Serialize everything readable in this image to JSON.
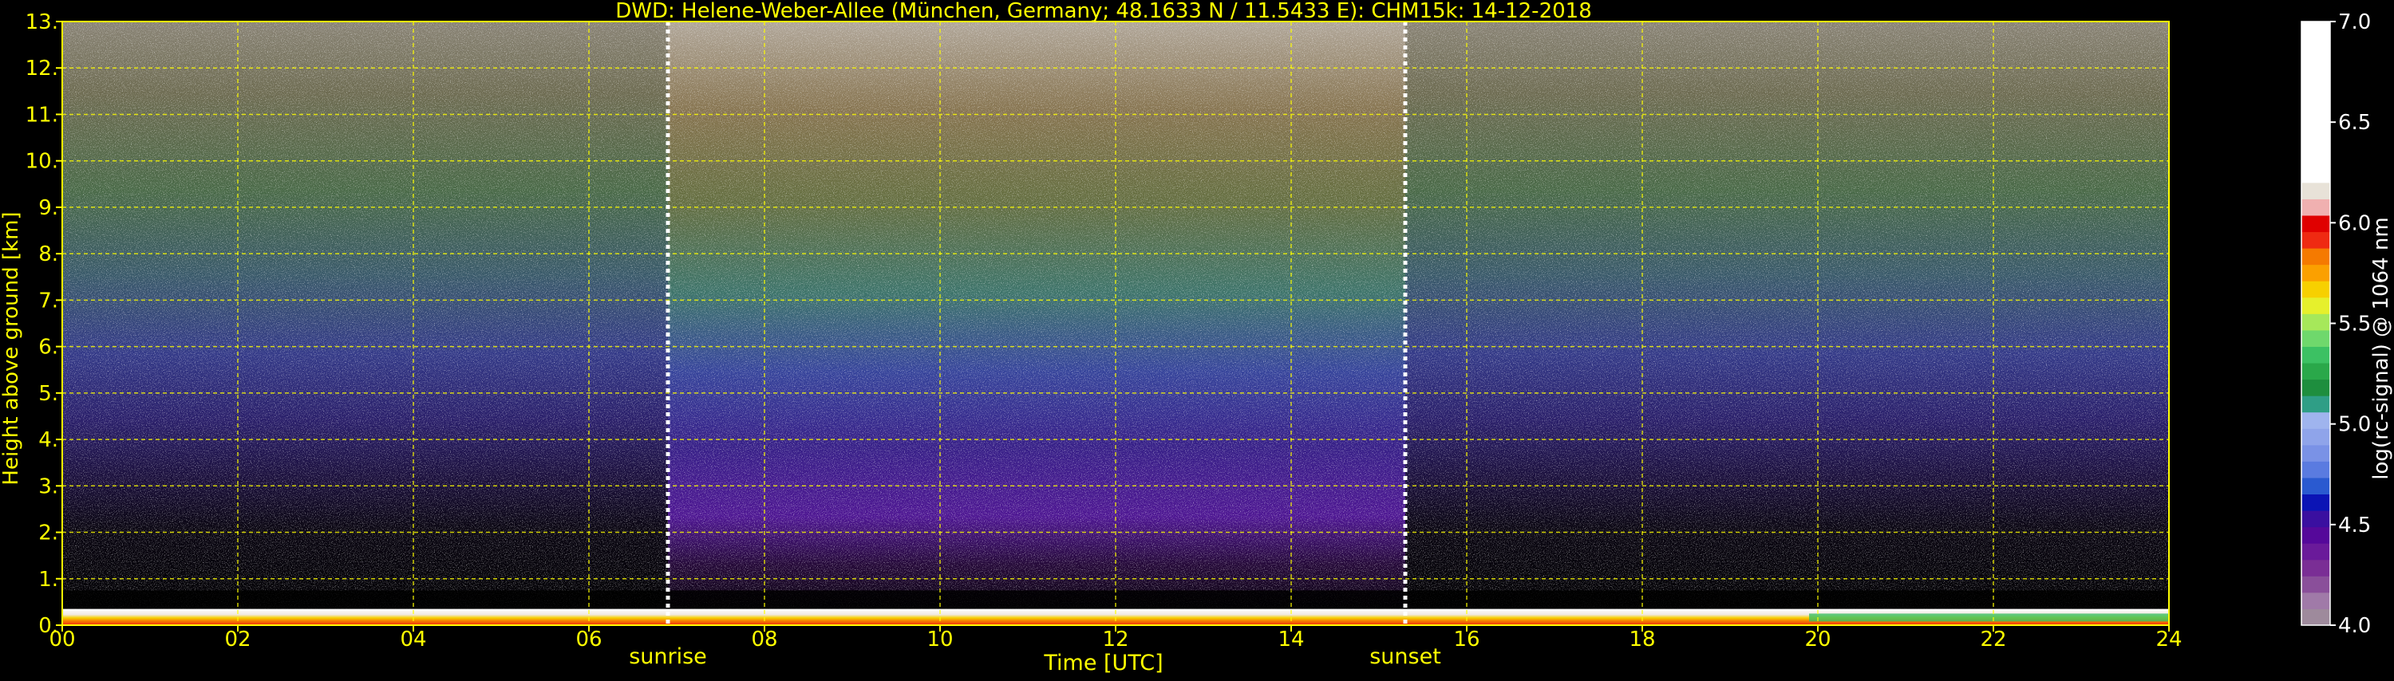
{
  "chart_data": {
    "type": "heatmap",
    "title": "DWD: Helene-Weber-Allee (München, Germany; 48.1633 N / 11.5433 E):    CHM15k: 14-12-2018",
    "xlabel": "Time [UTC]",
    "ylabel": "Height above ground [km]",
    "xlim": [
      0,
      24
    ],
    "ylim": [
      0,
      13
    ],
    "x_ticks": [
      "00",
      "02",
      "04",
      "06",
      "08",
      "10",
      "12",
      "14",
      "16",
      "18",
      "20",
      "22",
      "24"
    ],
    "y_ticks": [
      "0.",
      "1.",
      "2.",
      "3.",
      "4.",
      "5.",
      "6.",
      "7.",
      "8.",
      "9.",
      "10.",
      "11.",
      "12.",
      "13."
    ],
    "grid": true,
    "markers": [
      {
        "label": "sunrise",
        "x": 6.9
      },
      {
        "label": "sunset",
        "x": 15.3
      }
    ],
    "colorbar": {
      "label": "log(rc-signal) @ 1064 nm",
      "range": [
        4.0,
        7.0
      ],
      "ticks": [
        "4.0",
        "4.5",
        "5.0",
        "5.5",
        "6.0",
        "6.5",
        "7.0"
      ],
      "colors": [
        "#9e8a9c",
        "#a07aa8",
        "#8a4f9a",
        "#7a2e95",
        "#6a1a9a",
        "#55089a",
        "#3a0fa0",
        "#0b14b5",
        "#2a5ad0",
        "#5a7be0",
        "#7a92e6",
        "#8fa4ea",
        "#9fb4ee",
        "#2f9e86",
        "#1e8e3e",
        "#2aa84a",
        "#3cc163",
        "#6fd86c",
        "#a6e85a",
        "#e6f02c",
        "#f7d000",
        "#fba000",
        "#f57a00",
        "#ef2a12",
        "#e00000",
        "#f0b0b0",
        "#e8e2d8",
        "#ffffff"
      ]
    }
  }
}
